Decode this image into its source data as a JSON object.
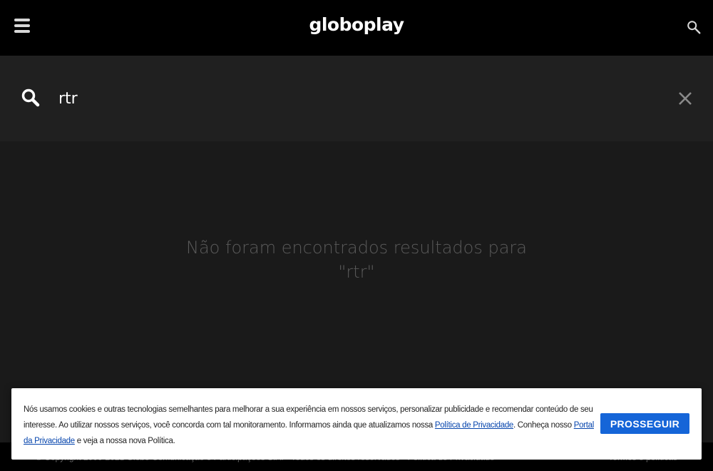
{
  "header": {
    "logo_text": "globoplay",
    "menu_icon": "hamburger-menu-icon",
    "search_icon": "search-icon"
  },
  "search": {
    "query": "rtr",
    "search_icon": "search-icon",
    "clear_icon": "close-icon"
  },
  "results": {
    "message_line1": "Não foram encontrados resultados para",
    "message_line2": "\"rtr\""
  },
  "footer": {
    "copyright": "© Copyright 2000-2021 Globo Comunicação e Participações S.A.  ·  Todos os direitos reservados  ·  Política de Privacidade",
    "terms": "Termos e políticas"
  },
  "cookie_banner": {
    "text_part1": "Nós usamos cookies e outras tecnologias semelhantes para melhorar a sua experiência em nossos serviços, personalizar publicidade e recomendar conteúdo de seu interesse. Ao utilizar nossos serviços, você concorda com tal monitoramento. Informamos ainda que atualizamos nossa ",
    "privacy_policy_link": "Política de Privacidade",
    "text_part2": ". Conheça nosso ",
    "privacy_portal_link": "Portal da Privacidade",
    "text_part3": " e veja a nossa nova Política.",
    "button_label": "PROSSEGUIR"
  },
  "colors": {
    "background": "#1a1a1a",
    "topbar": "#000000",
    "searchbar": "#202020",
    "accent_button": "#1565d8",
    "muted_text": "#5a5a5a"
  }
}
